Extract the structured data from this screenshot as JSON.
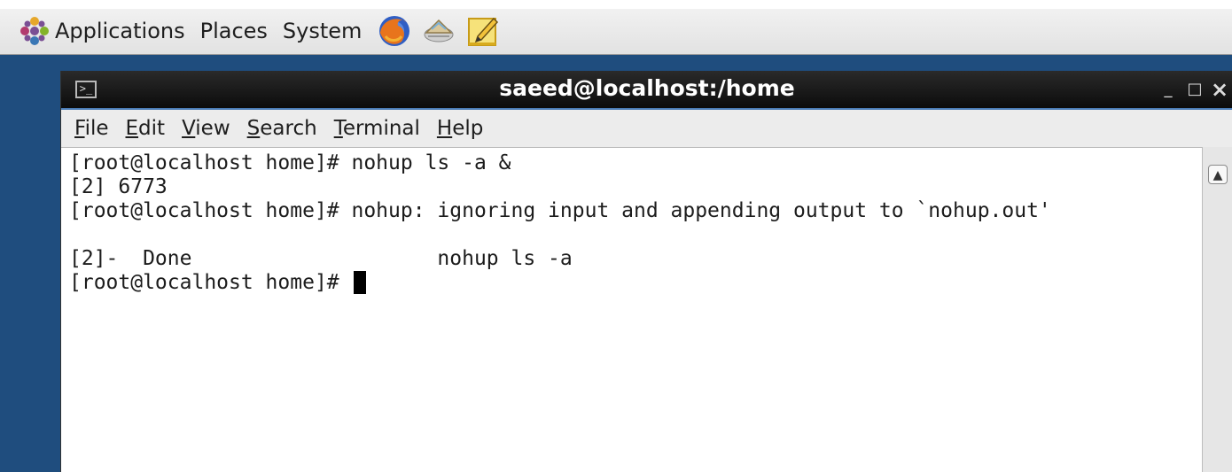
{
  "panel": {
    "menus": [
      "Applications",
      "Places",
      "System"
    ],
    "launchers": [
      {
        "icon": "firefox-icon"
      },
      {
        "icon": "mail-icon"
      },
      {
        "icon": "notes-icon"
      }
    ]
  },
  "window": {
    "title": "saeed@localhost:/home",
    "terminal_icon": "terminal-icon",
    "controls": {
      "minimize": "_",
      "maximize": "□",
      "close": "×"
    },
    "menu": [
      "File",
      "Edit",
      "View",
      "Search",
      "Terminal",
      "Help"
    ],
    "menu_mnemonics": [
      "F",
      "E",
      "V",
      "S",
      "T",
      "H"
    ]
  },
  "terminal": {
    "lines": [
      "[root@localhost home]# nohup ls -a &",
      "[2] 6773",
      "[root@localhost home]# nohup: ignoring input and appending output to `nohup.out'",
      "",
      "[2]-  Done                    nohup ls -a",
      "[root@localhost home]# "
    ]
  },
  "colors": {
    "titlebar": "#111111",
    "title_text": "#ffffff",
    "terminal_bg": "#ffffff",
    "terminal_text": "#1c1c1c",
    "panel_bg": "#ebebeb"
  }
}
